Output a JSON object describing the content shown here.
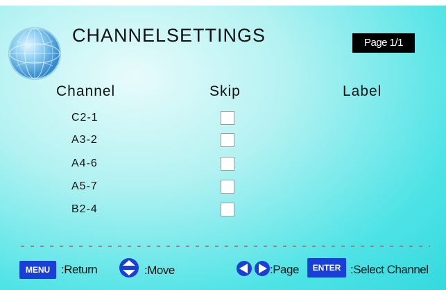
{
  "header": {
    "title": "CHANNELSETTINGS",
    "page_indicator": "Page 1/1"
  },
  "columns": {
    "channel": "Channel",
    "skip": "Skip",
    "label": "Label"
  },
  "rows": [
    {
      "channel": "C2-1",
      "skip": false
    },
    {
      "channel": "A3-2",
      "skip": false
    },
    {
      "channel": "A4-6",
      "skip": false
    },
    {
      "channel": "A5-7",
      "skip": false
    },
    {
      "channel": "B2-4",
      "skip": false
    }
  ],
  "footer": {
    "menu_key": "MENU",
    "menu_hint": ":Return",
    "move_icon": "up-down-arrows-icon",
    "move_hint": ":Move",
    "page_icon": "left-right-arrows-icon",
    "page_hint": ":Page",
    "enter_key": "ENTER",
    "enter_hint": ":Select Channel"
  },
  "colors": {
    "background": "#3cdfe2",
    "key_blue": "#1a3fd6",
    "badge_bg": "#000000"
  }
}
